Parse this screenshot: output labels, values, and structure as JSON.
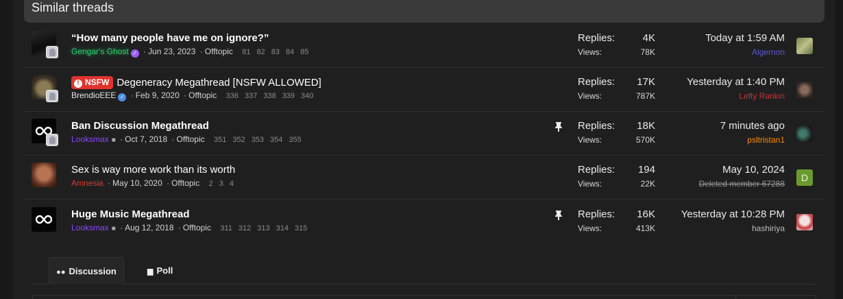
{
  "block": {
    "title": "Similar threads"
  },
  "threads": [
    {
      "title": "“How many people have me on ignore?”",
      "author": "Gengar's Ghost",
      "date": "Jun 23, 2023",
      "forum": "Offtopic",
      "pages": [
        "81",
        "82",
        "83",
        "84",
        "85"
      ],
      "replies_label": "Replies:",
      "replies": "4K",
      "views_label": "Views:",
      "views": "78K",
      "last_time": "Today at 1:59 AM",
      "last_user": "Algernon"
    },
    {
      "prefix": "NSFW",
      "title": "Degeneracy Megathread [NSFW ALLOWED]",
      "author": "BrendioEEE",
      "date": "Feb 9, 2020",
      "forum": "Offtopic",
      "pages": [
        "336",
        "337",
        "338",
        "339",
        "340"
      ],
      "replies_label": "Replies:",
      "replies": "17K",
      "views_label": "Views:",
      "views": "787K",
      "last_time": "Yesterday at 1:40 PM",
      "last_user": "Lefty Rankin"
    },
    {
      "title": "Ban Discussion Megathread",
      "author": "Looksmax",
      "date": "Oct 7, 2018",
      "forum": "Offtopic",
      "pages": [
        "351",
        "352",
        "353",
        "354",
        "355"
      ],
      "replies_label": "Replies:",
      "replies": "18K",
      "views_label": "Views:",
      "views": "570K",
      "last_time": "7 minutes ago",
      "last_user": "psltristan1"
    },
    {
      "title": "Sex is way more work than its worth",
      "author": "Amnesia",
      "date": "May 10, 2020",
      "forum": "Offtopic",
      "pages": [
        "2",
        "3",
        "4"
      ],
      "replies_label": "Replies:",
      "replies": "194",
      "views_label": "Views:",
      "views": "22K",
      "last_time": "May 10, 2024",
      "last_user": "Deleted member 67288",
      "last_avatar_letter": "D"
    },
    {
      "title": "Huge Music Megathread",
      "author": "Looksmax",
      "date": "Aug 12, 2018",
      "forum": "Offtopic",
      "pages": [
        "311",
        "312",
        "313",
        "314",
        "315"
      ],
      "replies_label": "Replies:",
      "replies": "16K",
      "views_label": "Views:",
      "views": "413K",
      "last_time": "Yesterday at 10:28 PM",
      "last_user": "hashiriya"
    }
  ],
  "tabs": {
    "discussion": "Discussion",
    "poll": "Poll"
  },
  "colors": {
    "username_green": "#2ecc71",
    "username_purple": "#8a46ff",
    "username_red": "#e03a2e",
    "nsfw_prefix": "#e0332e",
    "last_user_blue": "#5a5ad8",
    "last_user_red": "#c8343a",
    "last_user_orange": "#ff8a00"
  },
  "icons": {
    "verified": "check-badge-icon",
    "pinned": "pin-icon",
    "bot": "robot-icon",
    "discussion": "comments-icon",
    "poll": "bar-chart-icon",
    "logo": "infinity-logo-icon"
  }
}
